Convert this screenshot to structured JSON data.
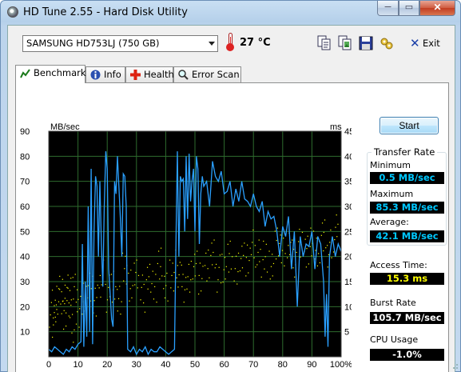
{
  "window": {
    "title": "HD Tune 2.55 - Hard Disk Utility",
    "min_label": "─",
    "max_label": "▭",
    "close_label": "✕"
  },
  "toolbar": {
    "drive": "SAMSUNG HD753LJ (750 GB)",
    "temperature": "27 °C",
    "icons": [
      "copy-text-icon",
      "copy-screenshot-icon",
      "save-icon",
      "options-icon"
    ],
    "exit_label": "Exit"
  },
  "tabs": [
    {
      "label": "Benchmark",
      "icon": "benchmark-icon",
      "active": true
    },
    {
      "label": "Info",
      "icon": "info-icon",
      "active": false
    },
    {
      "label": "Health",
      "icon": "health-icon",
      "active": false
    },
    {
      "label": "Error Scan",
      "icon": "error-scan-icon",
      "active": false
    }
  ],
  "benchmark": {
    "start_label": "Start",
    "transfer_rate_title": "Transfer Rate",
    "minimum_label": "Minimum",
    "minimum_value": "0.5 MB/sec",
    "maximum_label": "Maximum",
    "maximum_value": "85.3 MB/sec",
    "average_label": "Average:",
    "average_value": "42.1 MB/sec",
    "access_time_label": "Access Time:",
    "access_time_value": "15.3 ms",
    "burst_rate_label": "Burst Rate",
    "burst_rate_value": "105.7 MB/sec",
    "cpu_usage_label": "CPU Usage",
    "cpu_usage_value": "-1.0%"
  },
  "colors": {
    "plot_bg": "#000000",
    "transfer_line": "#2aa0ff",
    "access_points": "#ffff00",
    "grid": "#2e6b2e",
    "value_cyan": "#00c8ff",
    "value_yellow": "#ffff00"
  },
  "chart_data": {
    "type": "line",
    "ylabel": "MB/sec",
    "y2label": "ms",
    "ylim": [
      0,
      90
    ],
    "y2lim": [
      0,
      45
    ],
    "xlim": [
      0,
      100
    ],
    "y_ticks": [
      "90",
      "80",
      "70",
      "60",
      "50",
      "40",
      "30",
      "20",
      "10"
    ],
    "y2_ticks": [
      "45",
      "40",
      "35",
      "30",
      "25",
      "20",
      "15",
      "10",
      "5"
    ],
    "x_ticks": [
      "0",
      "10",
      "20",
      "30",
      "40",
      "50",
      "60",
      "70",
      "80",
      "90",
      "100%"
    ],
    "grid": true,
    "series": [
      {
        "name": "Transfer Rate",
        "axis": "left",
        "x": [
          0,
          1,
          2,
          3,
          4,
          5,
          6,
          7,
          8,
          9,
          10,
          11,
          11.5,
          12,
          12.5,
          13,
          13.5,
          14,
          14.5,
          15,
          15.5,
          16,
          16.5,
          17,
          17.5,
          18,
          18.5,
          19,
          19.5,
          20,
          20.5,
          21,
          21.5,
          22,
          22.5,
          23,
          23.5,
          24,
          24.5,
          25,
          25.5,
          26,
          26.5,
          27,
          28,
          29,
          30,
          31,
          32,
          33,
          34,
          35,
          36,
          37,
          38,
          39,
          40,
          41,
          42,
          43,
          43.5,
          44,
          44.5,
          45,
          45.5,
          46,
          46.5,
          47,
          47.5,
          48,
          48.5,
          49,
          49.5,
          50,
          50.5,
          51,
          51.5,
          52,
          52.5,
          53,
          54,
          55,
          56,
          57,
          58,
          59,
          60,
          61,
          62,
          63,
          64,
          65,
          66,
          67,
          68,
          69,
          70,
          71,
          72,
          73,
          74,
          75,
          76,
          77,
          78,
          79,
          80,
          81,
          82,
          83,
          84,
          85,
          86,
          87,
          88,
          89,
          90,
          91,
          92,
          93,
          94,
          94.5,
          95,
          95.5,
          96,
          97,
          98,
          99,
          100
        ],
        "values": [
          3,
          2,
          4,
          3,
          2,
          1,
          3,
          2,
          4,
          3,
          5,
          6,
          45,
          4,
          30,
          8,
          60,
          10,
          75,
          5,
          50,
          72,
          68,
          40,
          70,
          45,
          28,
          60,
          82,
          75,
          35,
          25,
          15,
          12,
          70,
          65,
          80,
          68,
          55,
          40,
          73,
          72,
          60,
          3,
          2,
          4,
          1,
          3,
          2,
          4,
          1,
          3,
          2,
          2,
          4,
          3,
          2,
          1,
          2,
          3,
          45,
          82,
          40,
          72,
          70,
          71,
          50,
          80,
          55,
          81,
          62,
          70,
          75,
          50,
          80,
          75,
          45,
          65,
          72,
          68,
          70,
          60,
          78,
          72,
          70,
          74,
          65,
          66,
          70,
          60,
          67,
          62,
          70,
          63,
          62,
          60,
          65,
          60,
          58,
          62,
          52,
          58,
          55,
          56,
          50,
          40,
          52,
          48,
          56,
          35,
          50,
          20,
          48,
          40,
          45,
          44,
          50,
          35,
          48,
          45,
          30,
          8,
          25,
          4,
          40,
          48,
          40,
          45,
          42
        ]
      },
      {
        "name": "Access Time",
        "axis": "right",
        "type": "scatter",
        "x": [
          1,
          2,
          3,
          4,
          5,
          6,
          7,
          8,
          9,
          10,
          12,
          14,
          16,
          18,
          20,
          22,
          24,
          26,
          28,
          30,
          32,
          34,
          36,
          38,
          40,
          42,
          44,
          46,
          48,
          50,
          52,
          54,
          56,
          58,
          60,
          62,
          64,
          66,
          68,
          70,
          72,
          74,
          76,
          78,
          80,
          82,
          84,
          86,
          88,
          90,
          92,
          94,
          96,
          98
        ],
        "values": [
          10,
          8,
          12,
          14,
          9,
          11,
          13,
          7,
          15,
          10,
          12,
          14,
          11,
          16,
          13,
          15,
          12,
          18,
          14,
          16,
          13,
          17,
          15,
          19,
          14,
          16,
          18,
          15,
          17,
          19,
          16,
          18,
          20,
          17,
          19,
          21,
          18,
          20,
          19,
          22,
          20,
          21,
          19,
          23,
          21,
          22,
          20,
          24,
          22,
          23,
          21,
          24,
          22,
          25
        ]
      }
    ]
  }
}
